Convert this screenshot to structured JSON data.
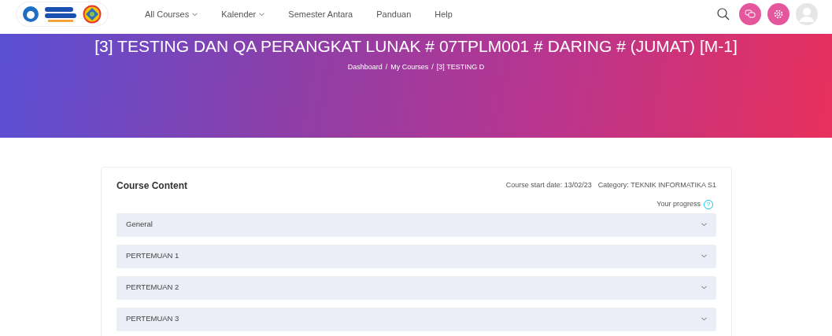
{
  "navbar": {
    "menu": [
      {
        "label": "All Courses",
        "dropdown": true
      },
      {
        "label": "Kalender",
        "dropdown": true
      },
      {
        "label": "Semester Antara",
        "dropdown": false
      },
      {
        "label": "Panduan",
        "dropdown": false
      },
      {
        "label": "Help",
        "dropdown": false
      }
    ]
  },
  "banner": {
    "title": "[3] TESTING DAN QA PERANGKAT LUNAK # 07TPLM001 # DARING # (JUMAT) [M-1]",
    "breadcrumb": [
      "Dashboard",
      "My Courses",
      "[3] TESTING D"
    ],
    "separator": "/"
  },
  "course": {
    "heading": "Course Content",
    "start_date": "Course start date: 13/02/23",
    "category": "Category: TEKNIK INFORMATIKA S1",
    "progress_label": "Your progress",
    "help_icon": "?",
    "sections": [
      {
        "title": "General",
        "expanded": false
      },
      {
        "title": "PERTEMUAN 1",
        "expanded": false
      },
      {
        "title": "PERTEMUAN 2",
        "expanded": false
      },
      {
        "title": "PERTEMUAN 3",
        "expanded": false
      }
    ]
  }
}
